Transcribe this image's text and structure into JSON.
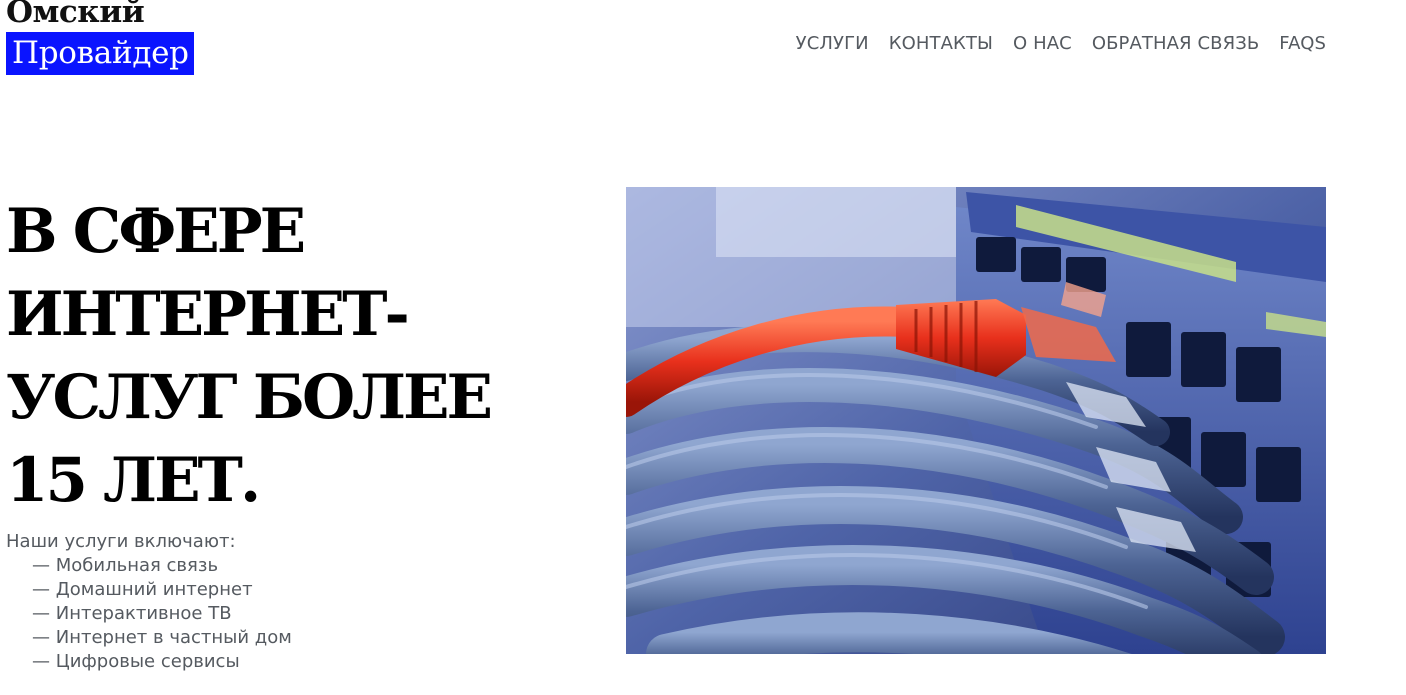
{
  "logo": {
    "line1": "Омский",
    "line2": "Провайдер",
    "highlight_color": "#0a14ff"
  },
  "nav": {
    "items": [
      {
        "label": "УСЛУГИ"
      },
      {
        "label": "КОНТАКТЫ"
      },
      {
        "label": "О НАС"
      },
      {
        "label": "ОБРАТНАЯ СВЯЗЬ"
      },
      {
        "label": "FAQS"
      }
    ]
  },
  "hero": {
    "title": "В СФЕРЕ ИНТЕРНЕТ-УСЛУГ БОЛЕЕ 15 ЛЕТ.",
    "services_intro": "Наши услуги включают:",
    "services": [
      "Мобильная связь",
      "Домашний интернет",
      "Интерактивное ТВ",
      "Интернет в частный дом",
      "Цифровые сервисы"
    ],
    "image": {
      "subject": "network-switch-with-ethernet-cables",
      "cable_accent_color": "#e8301c",
      "cable_color": "#4a6088"
    }
  }
}
